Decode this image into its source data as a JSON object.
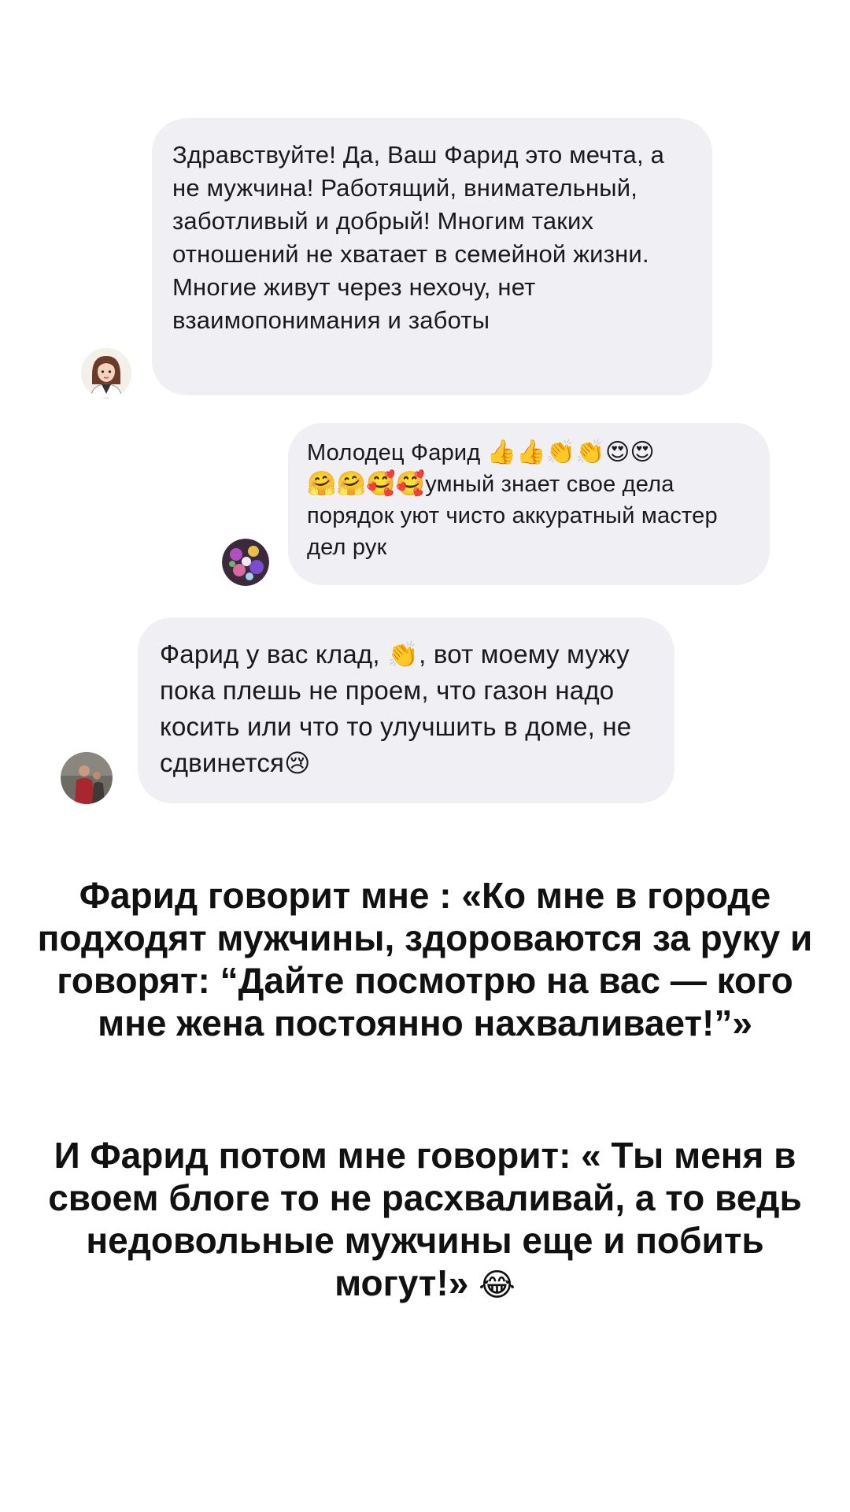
{
  "comments": [
    {
      "text": "Здравствуйте! Да, Ваш Фарид это мечта, а не мужчина! Работящий, внимательный, заботливый и добрый! Многим таких отношений не хватает в семейной жизни. Многие живут через нехочу, нет взаимопонимания и заботы",
      "avatar_icon": "cartoon-woman-avatar-icon"
    },
    {
      "text_before_emoji": "Молодец Фарид",
      "emojis_line1": "👍👍👏👏😍😍",
      "emojis_line2": "🤗🤗🥰🥰",
      "text_after_emoji": "умный знает свое дела порядок уют чисто аккуратный мастер дел рук",
      "avatar_icon": "flowers-avatar-icon"
    },
    {
      "text_part1": "Фарид у вас клад,",
      "emoji_clap": "👏",
      "text_part2": ", вот моему мужу пока плешь не проем, что газон надо косить или что то улучшить в доме, не сдвинется",
      "emoji_cry": "😢",
      "avatar_icon": "photo-avatar-icon"
    }
  ],
  "story_text": {
    "paragraph1": "Фарид говорит мне : «Ко мне в городе подходят мужчины, здороваются за руку и говорят: “Дайте посмотрю на вас — кого мне жена постоянно нахваливает!”»",
    "paragraph2": "И Фарид  потом мне говорит: « Ты меня в своем блоге то не расхваливай, а то ведь недовольные мужчины еще и побить могут!»",
    "paragraph2_emoji": "😂"
  },
  "colors": {
    "bubble_bg": "#efeff4",
    "text": "#111111"
  }
}
